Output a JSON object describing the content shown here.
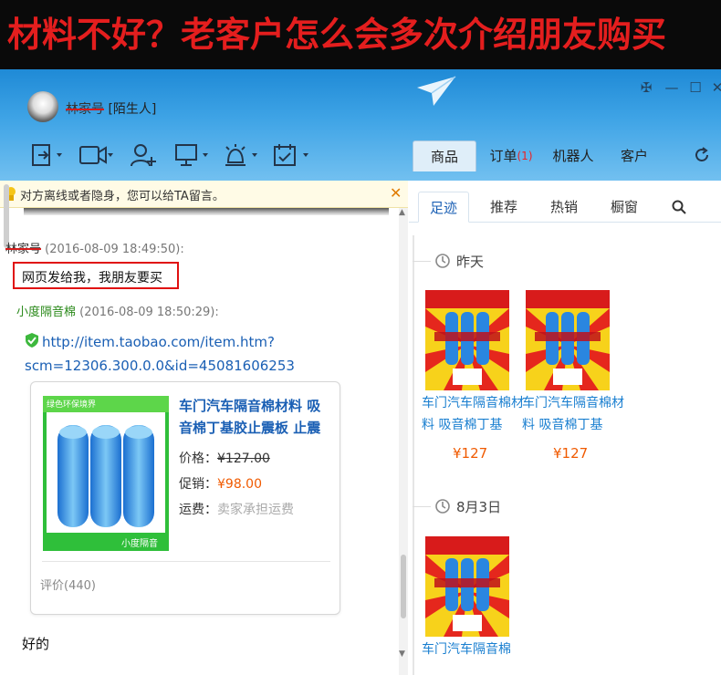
{
  "banner": {
    "text": "材料不好？老客户怎么会多次介绍朋友购买"
  },
  "header": {
    "nickname": "林家号",
    "nickname_tag": "[陌生人]",
    "tabs": [
      {
        "label": "商品"
      },
      {
        "label": "订单",
        "badge": "(1)"
      },
      {
        "label": "机器人"
      },
      {
        "label": "客户"
      }
    ]
  },
  "chat": {
    "notice": "对方离线或者隐身，您可以给TA留言。",
    "messages": [
      {
        "sender": "林家号",
        "time": "(2016-08-09 18:49:50):",
        "text": "网页发给我，我朋友要买"
      },
      {
        "sender": "小度隔音棉",
        "time": "(2016-08-09 18:50:29):",
        "link_line1": "http://item.taobao.com/item.htm?",
        "link_line2": "scm=12306.300.0.0&id=45081606253"
      },
      {
        "text": "好的"
      }
    ],
    "card": {
      "image_top_text": "绿色环保境界",
      "image_bottom_text": "小度隔音",
      "title": "车门汽车隔音棉材料 吸音棉丁基胶止震板 止震",
      "price_label": "价格：",
      "price_value": "¥127.00",
      "promo_label": "促销：",
      "promo_value": "¥98.00",
      "ship_label": "运费：",
      "ship_value": "卖家承担运费",
      "rating": "评价(440)"
    }
  },
  "right_panel": {
    "subtabs": [
      "足迹",
      "推荐",
      "热销",
      "橱窗"
    ],
    "groups": [
      {
        "day": "昨天",
        "products": [
          {
            "title": "车门汽车隔音棉材料 吸音棉丁基",
            "price": "¥127"
          },
          {
            "title": "车门汽车隔音棉材料 吸音棉丁基",
            "price": "¥127"
          }
        ]
      },
      {
        "day": "8月3日",
        "products": [
          {
            "title": "车门汽车隔音棉",
            "price": ""
          }
        ]
      }
    ]
  },
  "colors": {
    "banner_text": "#e41e1e",
    "header_blue": "#3fa4e6",
    "link_blue": "#1a5fb4",
    "price_orange": "#f05a00",
    "highlight_red": "#e01010"
  }
}
